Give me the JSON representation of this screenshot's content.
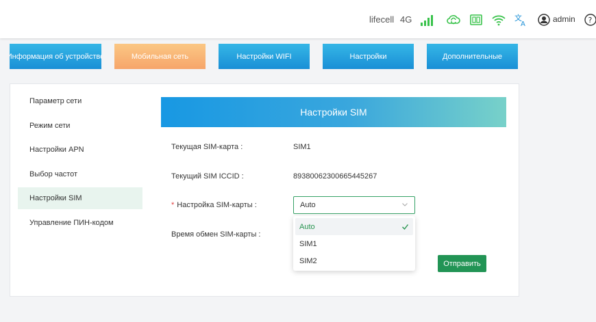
{
  "header": {
    "operator": "lifecell",
    "network_type": "4G",
    "admin_label": "admin",
    "icons": [
      "signal-icon",
      "cloud-sync-icon",
      "sim-card-icon",
      "wifi-icon",
      "language-icon",
      "user-icon",
      "help-icon"
    ],
    "accent_color": "#38c24a"
  },
  "nav": {
    "items": [
      {
        "label": "Информация об устройстве"
      },
      {
        "label": "Мобильная сеть"
      },
      {
        "label": "Настройки WIFI"
      },
      {
        "label": "Настройки"
      },
      {
        "label": "Дополнительные"
      }
    ],
    "active_index": 1
  },
  "sidebar": {
    "items": [
      {
        "label": "Параметр сети"
      },
      {
        "label": "Режим сети"
      },
      {
        "label": "Настройки APN"
      },
      {
        "label": "Выбор частот"
      },
      {
        "label": "Настройки SIM"
      },
      {
        "label": "Управление ПИН-кодом"
      }
    ],
    "active_index": 4
  },
  "main": {
    "title": "Настройки SIM",
    "current_sim_label": "Текущая SIM-карта :",
    "current_sim_value": "SIM1",
    "iccid_label": "Текущий SIM ICCID :",
    "iccid_value": "89380062300665445267",
    "sim_setting_required": "*",
    "sim_setting_label": "Настройка SIM-карты :",
    "sim_setting_value": "Auto",
    "swap_time_label": "Время обмен SIM-карты :",
    "dropdown_options": [
      "Auto",
      "SIM1",
      "SIM2"
    ],
    "submit_label": "Отправить",
    "brand_green": "#229455"
  }
}
